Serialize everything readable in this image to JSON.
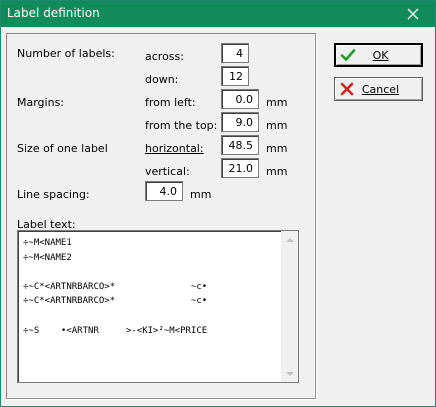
{
  "window": {
    "title": "Label definition"
  },
  "labels_count": {
    "label": "Number of labels:",
    "across_label": "across:",
    "across_value": "4",
    "down_label": "down:",
    "down_value": "12"
  },
  "margins": {
    "label": "Margins:",
    "from_left_label": "from left:",
    "from_left_value": "0.0",
    "from_left_unit": "mm",
    "from_top_label": "from the top:",
    "from_top_value": "9.0",
    "from_top_unit": "mm"
  },
  "label_size": {
    "label": "Size of one label",
    "horizontal_label": "horizontal:",
    "horizontal_value": "48.5",
    "horizontal_unit": "mm",
    "vertical_label": "vertical:",
    "vertical_value": "21.0",
    "vertical_unit": "mm"
  },
  "line_spacing": {
    "label": "Line spacing:",
    "value": "4.0",
    "unit": "mm"
  },
  "label_text": {
    "label": "Label text:",
    "lines": [
      "÷~M<NAME1",
      "÷~M<NAME2",
      "",
      "÷~C*<ARTNRBARCO>*              ~c•",
      "÷~C*<ARTNRBARCO>*              ~c•",
      "",
      "÷~S    •<ARTNR     >-<KI>²~M<PRICE"
    ]
  },
  "buttons": {
    "ok": "OK",
    "cancel": "Cancel"
  },
  "colors": {
    "titlebar": "#118a5c",
    "ok_icon": "#1a9e2a",
    "cancel_icon": "#d42020"
  }
}
